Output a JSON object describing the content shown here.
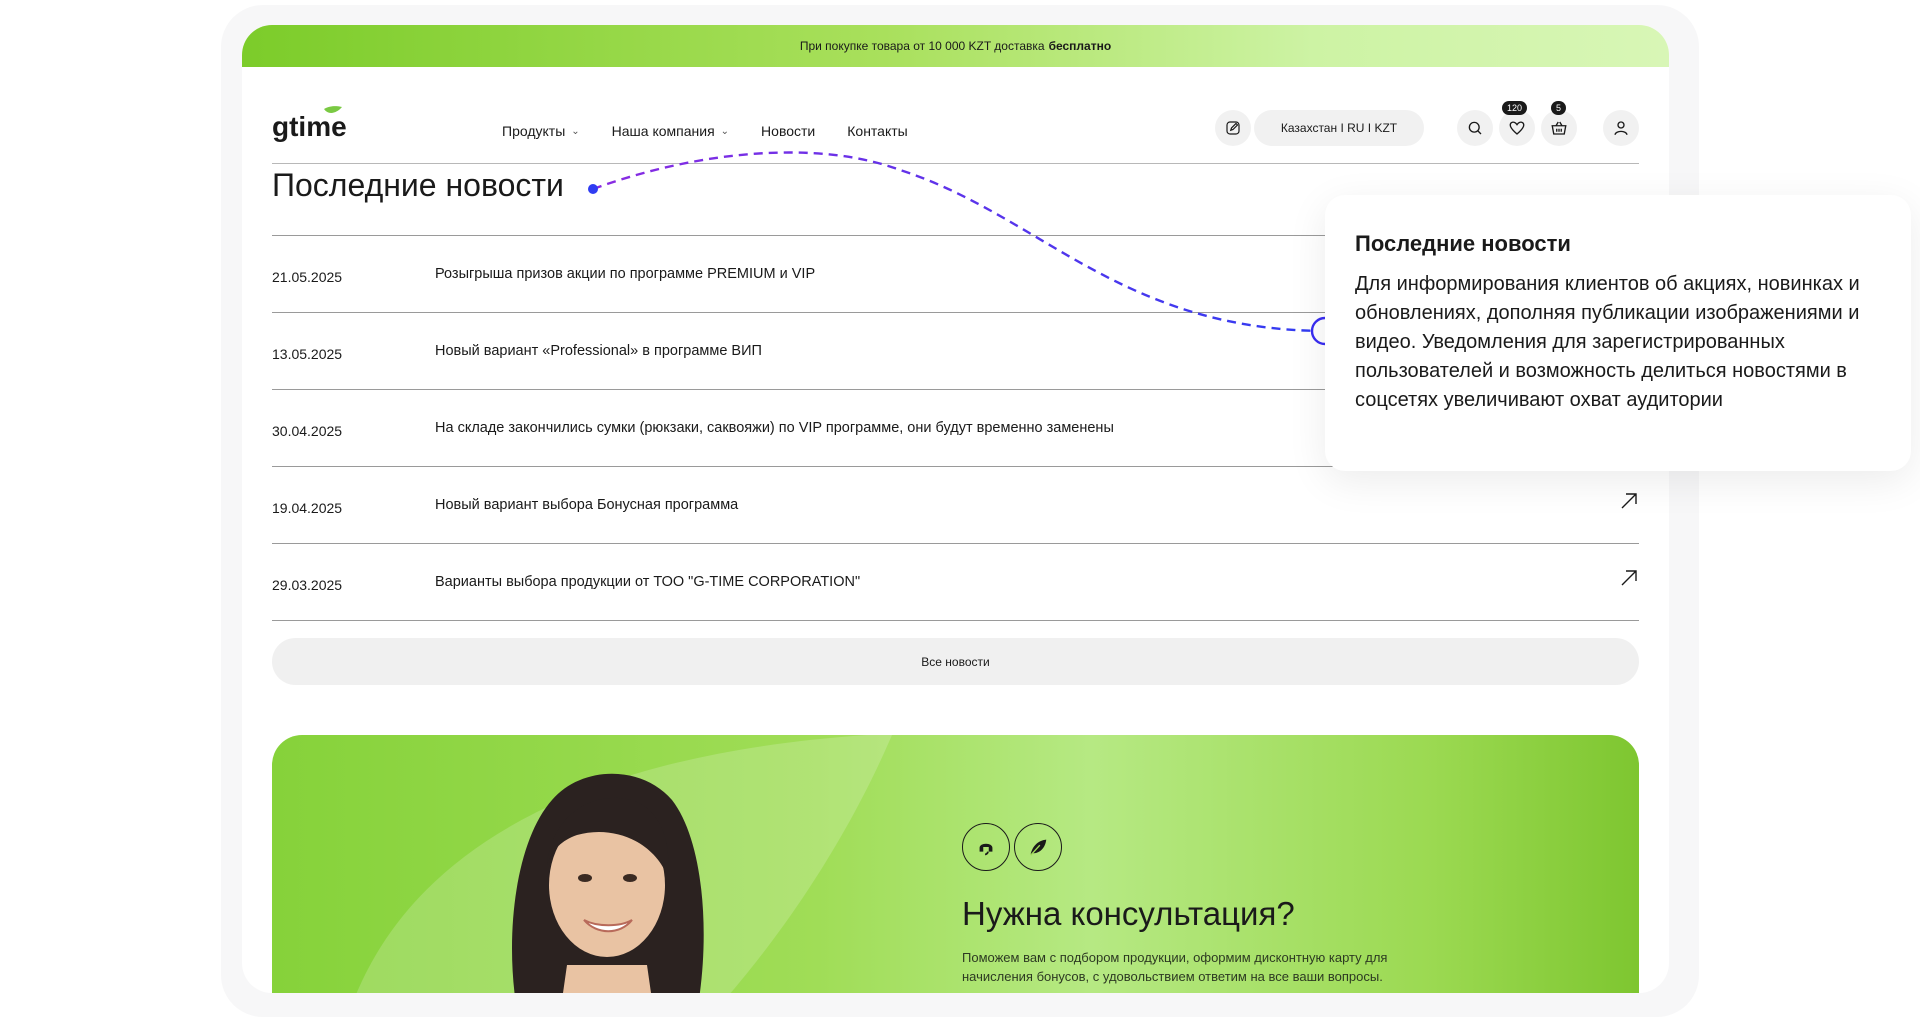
{
  "promo": {
    "text": "При покупке товара от 10 000 KZT доставка",
    "bold": "бесплатно"
  },
  "header": {
    "nav": [
      {
        "label": "Продукты",
        "dropdown": true
      },
      {
        "label": "Наша компания",
        "dropdown": true
      },
      {
        "label": "Новости",
        "dropdown": false
      },
      {
        "label": "Контакты",
        "dropdown": false
      }
    ],
    "region": "Казахстан I RU I KZT",
    "favorites_count": "120",
    "cart_count": "5",
    "icons": [
      "edit-icon",
      "search-icon",
      "heart-icon",
      "basket-icon",
      "user-icon"
    ]
  },
  "news": {
    "title": "Последние новости",
    "items": [
      {
        "date": "21.05.2025",
        "text": "Розыгрыша призов акции по программе PREMIUM и VIP"
      },
      {
        "date": "13.05.2025",
        "text": "Новый вариант «Professional» в программе ВИП"
      },
      {
        "date": "30.04.2025",
        "text": "На складе закончились сумки (рюкзаки, саквояжи) по VIP программе, они будут временно заменены"
      },
      {
        "date": "19.04.2025",
        "text": "Новый вариант выбора Бонусная программа"
      },
      {
        "date": "29.03.2025",
        "text": "Варианты выбора продукции от ТОО \"G-TIME CORPORATION\""
      }
    ],
    "all_button": "Все новости"
  },
  "consult": {
    "title": "Нужна консультация?",
    "text": "Поможем вам с подбором продукции, оформим дисконтную карту для начисления бонусов, с удовольствием ответим на все ваши вопросы."
  },
  "callout": {
    "title": "Последние новости",
    "text": "Для информирования клиентов об акциях, новинках и обновлениях, дополняя публикации изображениями и видео. Уведомления для зарегистрированных пользователей и возможность делиться новостями в соцсетях увеличивают охват аудитории"
  },
  "colors": {
    "accent": "#86d23a",
    "connector": "#3a2ef2"
  }
}
